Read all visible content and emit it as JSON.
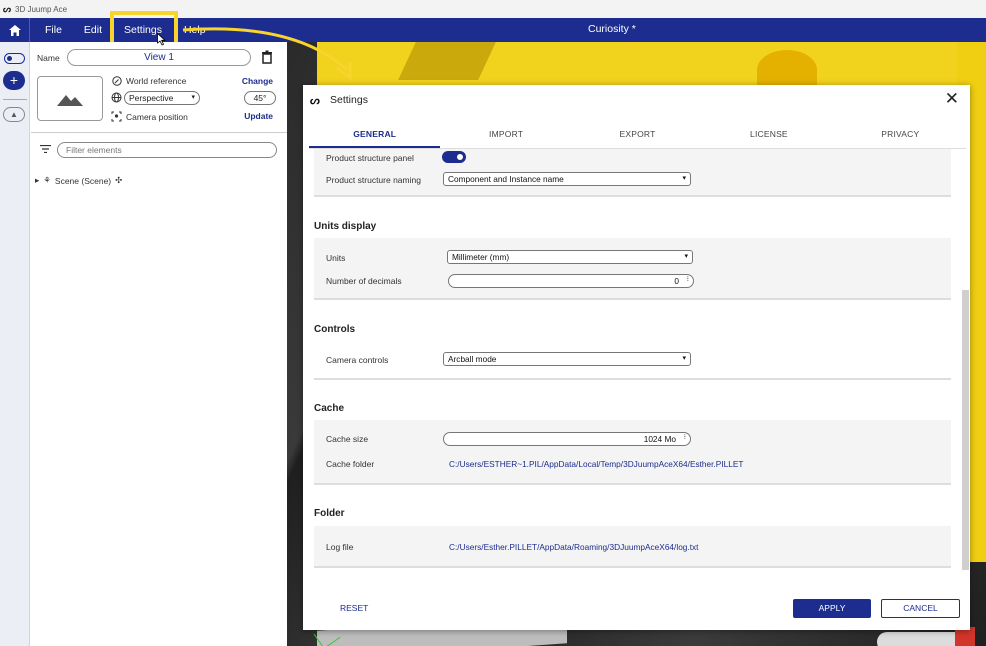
{
  "app": {
    "title": "3D Juump Ace",
    "document_title": "Curiosity *"
  },
  "menu": {
    "file": "File",
    "edit": "Edit",
    "settings": "Settings",
    "help": "Help"
  },
  "view_panel": {
    "name_label": "Name",
    "view_name": "View 1",
    "world_reference_label": "World reference",
    "change_link": "Change",
    "projection": "Perspective",
    "fov": "45°",
    "camera_position_label": "Camera position",
    "update_link": "Update",
    "filter_placeholder": "Filter elements",
    "tree_root": "Scene (Scene)"
  },
  "settings": {
    "title": "Settings",
    "tabs": [
      "GENERAL",
      "IMPORT",
      "EXPORT",
      "LICENSE",
      "PRIVACY"
    ],
    "active_tab": "GENERAL",
    "product_structure_panel_label": "Product structure panel",
    "product_structure_panel_on": true,
    "product_structure_naming_label": "Product structure naming",
    "product_structure_naming_value": "Component and Instance name",
    "units_section": "Units display",
    "units_label": "Units",
    "units_value": "Millimeter (mm)",
    "decimals_label": "Number of decimals",
    "decimals_value": "0",
    "controls_section": "Controls",
    "camera_controls_label": "Camera controls",
    "camera_controls_value": "Arcball mode",
    "cache_section": "Cache",
    "cache_size_label": "Cache size",
    "cache_size_value": "1024 Mo",
    "cache_folder_label": "Cache folder",
    "cache_folder_value": "C:/Users/ESTHER~1.PIL/AppData/Local/Temp/3DJuumpAceX64/Esther.PILLET",
    "folder_section": "Folder",
    "log_file_label": "Log file",
    "log_file_value": "C:/Users/Esther.PILLET/AppData/Roaming/3DJuumpAceX64/log.txt",
    "reset": "RESET",
    "apply": "APPLY",
    "cancel": "CANCEL"
  },
  "colors": {
    "accent": "#1c2d8f",
    "highlight": "#f7d52c"
  }
}
